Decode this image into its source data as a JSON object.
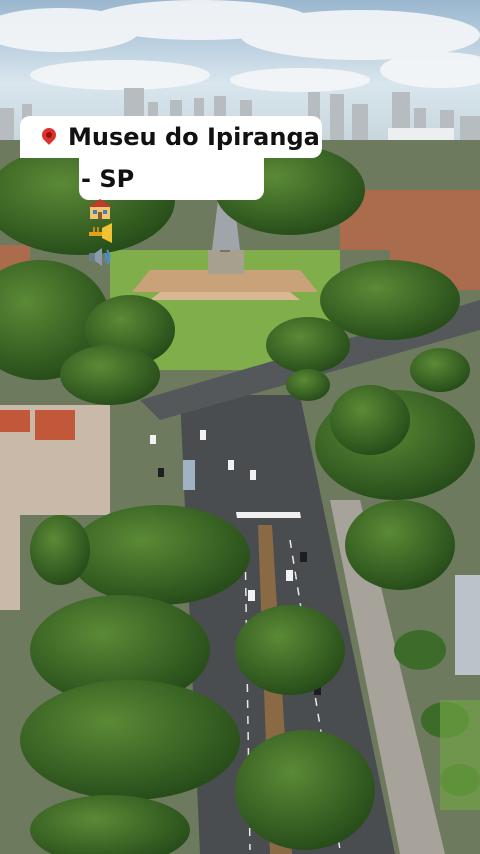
{
  "caption": {
    "line1": "Museu do Ipiranga",
    "line2": "- SP",
    "icons": [
      "round-pushpin-icon",
      "museum-building-icon",
      "trumpet-icon",
      "speaker-icon"
    ]
  },
  "colors": {
    "sky": "#cfe1ee",
    "cloud": "#f3f6f8",
    "foliage_dark": "#2f5a1f",
    "foliage_light": "#5f8f3a",
    "road": "#4a4d50",
    "lawn": "#7fae4a",
    "plaza": "#c79a6a"
  }
}
